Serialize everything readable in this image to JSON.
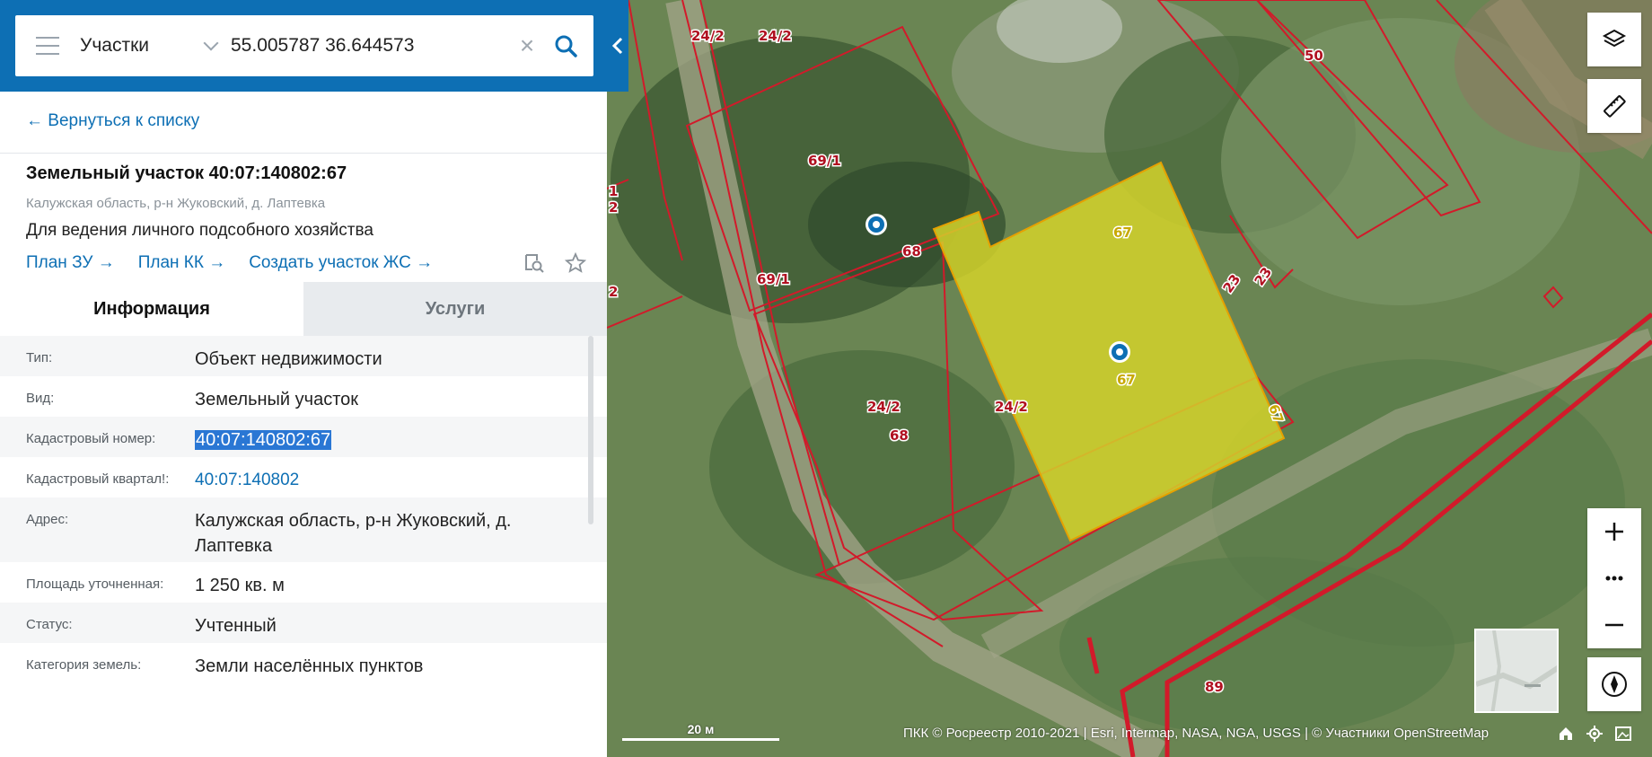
{
  "search": {
    "layer": "Участки",
    "value": "55.005787 36.644573"
  },
  "panel": {
    "back_label": "← Вернуться к списку",
    "title": "Земельный участок 40:07:140802:67",
    "address": "Калужская область, р-н Жуковский, д. Лаптевка",
    "use": "Для ведения личного подсобного хозяйства",
    "links": [
      "План ЗУ →",
      "План КК →",
      "Создать участок ЖС →"
    ],
    "tabs": [
      {
        "label": "Информация",
        "active": true
      },
      {
        "label": "Услуги",
        "active": false
      }
    ],
    "rows": [
      {
        "key": "Тип:",
        "value": "Объект недвижимости",
        "kind": "text"
      },
      {
        "key": "Вид:",
        "value": "Земельный участок",
        "kind": "text"
      },
      {
        "key": "Кадастровый номер:",
        "value": "40:07:140802:67",
        "kind": "highlight"
      },
      {
        "key": "Кадастровый квартал!:",
        "value": "40:07:140802",
        "kind": "link"
      },
      {
        "key": "Адрес:",
        "value": "Калужская область, р-н Жуковский, д. Лаптевка",
        "kind": "text"
      },
      {
        "key": "Площадь уточненная:",
        "value": "1 250 кв. м",
        "kind": "text"
      },
      {
        "key": "Статус:",
        "value": "Учтенный",
        "kind": "text"
      },
      {
        "key": "Категория земель:",
        "value": "Земли населённых пунктов",
        "kind": "text"
      }
    ]
  },
  "map": {
    "plot_labels": [
      {
        "text": "24/2"
      },
      {
        "text": "24/2"
      },
      {
        "text": "50"
      },
      {
        "text": "69/1"
      },
      {
        "text": "68"
      },
      {
        "text": "69/1"
      },
      {
        "text": "23"
      },
      {
        "text": "23"
      },
      {
        "text": "24/2"
      },
      {
        "text": "68"
      },
      {
        "text": "24/2"
      },
      {
        "text": "89"
      },
      {
        "text": "1"
      },
      {
        "text": "2"
      },
      {
        "text": "2"
      }
    ],
    "selected_labels": [
      "67",
      "67",
      "67"
    ],
    "scale_label": "20 м",
    "attribution": "ПКК © Росреестр 2010-2021 | Esri, Intermap, NASA, NGA, USGS | © Участники OpenStreetMap"
  },
  "colors": {
    "accent": "#0d6fb4",
    "selected_fill": "#d4d22a",
    "boundary": "#d21a2a"
  }
}
